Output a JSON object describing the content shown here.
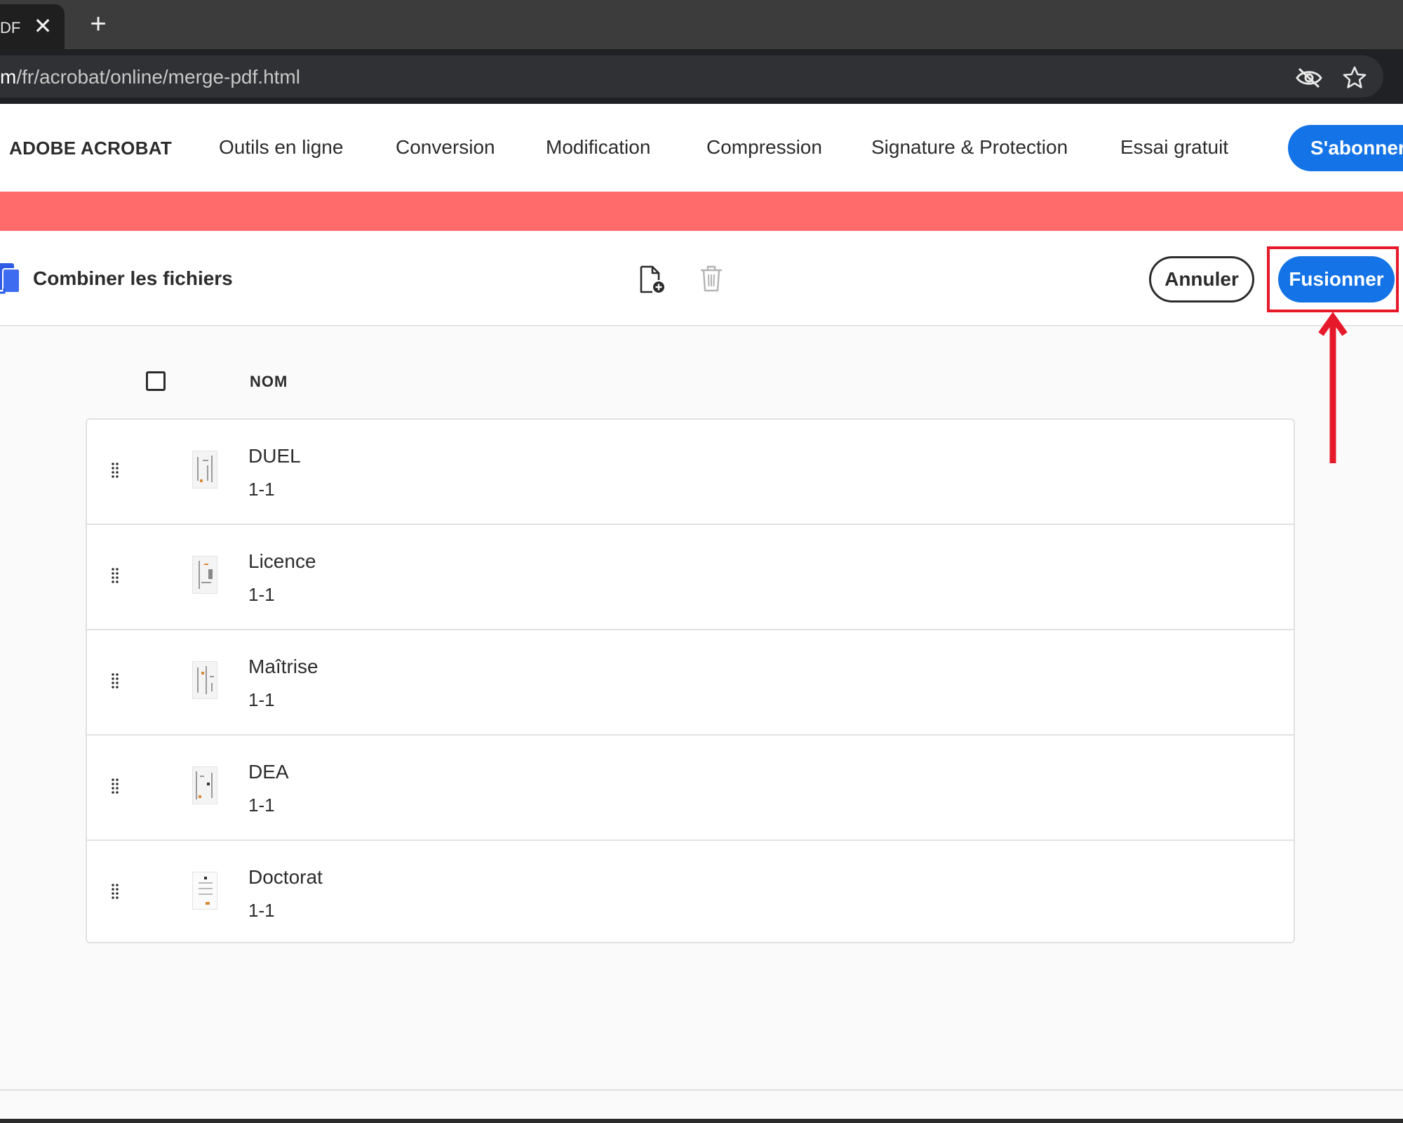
{
  "browser": {
    "tab_title": "DF",
    "url_host_tail": "m",
    "url_path": "/fr/acrobat/online/merge-pdf.html"
  },
  "nav": {
    "brand": "ADOBE ACROBAT",
    "items": [
      "Outils en ligne",
      "Conversion",
      "Modification",
      "Compression",
      "Signature & Protection",
      "Essai gratuit"
    ],
    "subscribe_label": "S'abonner"
  },
  "toolbar": {
    "title": "Combiner les fichiers",
    "cancel_label": "Annuler",
    "merge_label": "Fusionner"
  },
  "list": {
    "column_header": "NOM",
    "files": [
      {
        "name": "DUEL",
        "pages": "1-1"
      },
      {
        "name": "Licence",
        "pages": "1-1"
      },
      {
        "name": "Maîtrise",
        "pages": "1-1"
      },
      {
        "name": "DEA",
        "pages": "1-1"
      },
      {
        "name": "Doctorat",
        "pages": "1-1"
      }
    ]
  },
  "colors": {
    "accent": "#1473e6",
    "banner": "#ff6a6a",
    "annotation": "#e6192a"
  },
  "icons": {
    "tab_close": "close-icon",
    "new_tab": "plus-icon",
    "tracking": "eye-off-icon",
    "bookmark": "star-icon",
    "tool": "combine-files-icon",
    "add": "add-file-icon",
    "delete": "trash-icon",
    "drag": "drag-handle-icon"
  }
}
